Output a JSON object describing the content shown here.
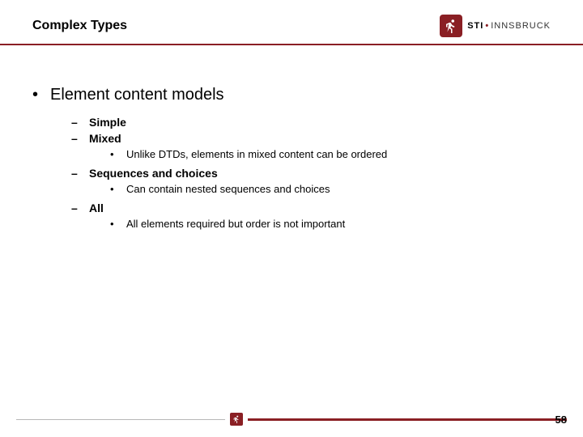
{
  "header": {
    "title": "Complex Types",
    "logo": {
      "brand_bold": "STI",
      "brand_rest": "INNSBRUCK"
    }
  },
  "content": {
    "l1": {
      "text": "Element content models"
    },
    "items": [
      {
        "label": "Simple",
        "subs": []
      },
      {
        "label": "Mixed",
        "subs": [
          {
            "text": "Unlike DTDs, elements in mixed content can be ordered"
          }
        ]
      },
      {
        "label": "Sequences and choices",
        "subs": [
          {
            "text": "Can contain nested sequences and choices"
          }
        ]
      },
      {
        "label": "All",
        "subs": [
          {
            "text": "All elements required but order is not important"
          }
        ]
      }
    ]
  },
  "footer": {
    "page_number": "58"
  }
}
